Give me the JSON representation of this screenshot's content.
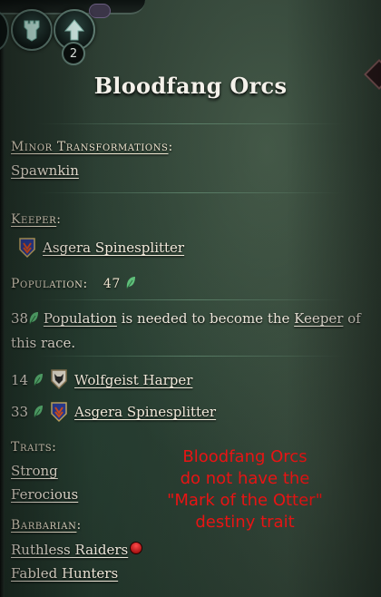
{
  "header": {
    "title": "Bloodfang Orcs",
    "badge_count": "2"
  },
  "minor_transformations": {
    "label": "Minor Transformations",
    "colon": ":",
    "items": [
      "Spawnkin"
    ]
  },
  "keeper": {
    "label": "Keeper",
    "colon": ":",
    "name": "Asgera Spinesplitter"
  },
  "population": {
    "label": "Population:",
    "value": "47",
    "req_value": "38",
    "req_link": "Population",
    "req_middle": " is needed to become the ",
    "req_keeper": "Keeper",
    "req_end": " of this race."
  },
  "rankings": [
    {
      "value": "14",
      "name": "Wolfgeist Harper"
    },
    {
      "value": "33",
      "name": "Asgera Spinesplitter"
    }
  ],
  "traits": {
    "label": "Traits:",
    "items": [
      "Strong",
      "Ferocious"
    ]
  },
  "barbarian": {
    "label": "Barbarian",
    "colon": ":",
    "items": [
      "Ruthless Raiders",
      "Fabled Hunters"
    ]
  },
  "annotation": "Bloodfang Orcs\ndo not have the\n\"Mark of the Otter\"\ndestiny trait",
  "colors": {
    "accent_red": "#e81414",
    "leaf_green": "#5fbf7a"
  },
  "icons": [
    "tower-icon",
    "upgrade-arrow-icon",
    "leaf-population-icon",
    "orc-crest-icon",
    "wolf-crest-icon",
    "red-orb-icon"
  ]
}
